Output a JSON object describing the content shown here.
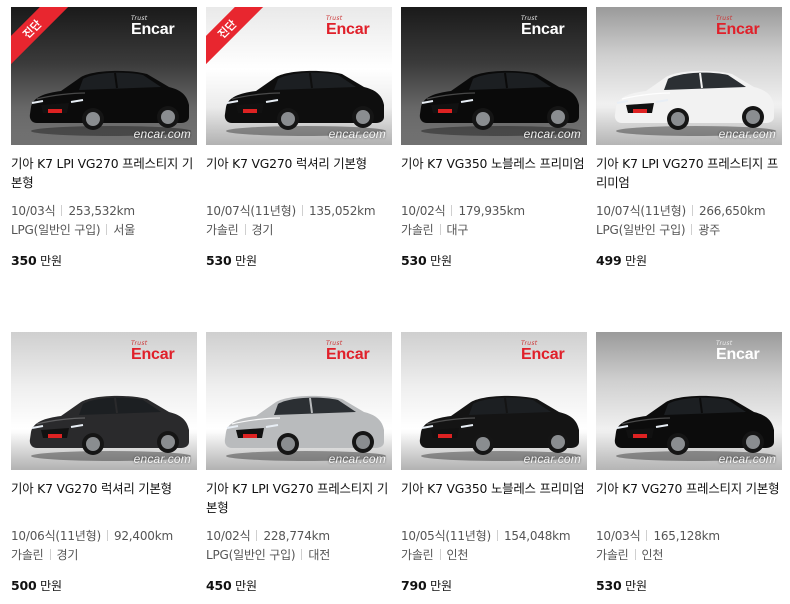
{
  "cars": [
    {
      "title": "기아 K7 LPI VG270 프레스티지 기본형",
      "year": "10/03식",
      "km": "253,532km",
      "fuel": "LPG(일반인 구입)",
      "region": "서울",
      "price": "350",
      "unit": "만원",
      "badge": "진단",
      "brand": "Encar",
      "brand_sub": "Trust",
      "watermark": "encar.com",
      "car_color": "#0b0b0b",
      "bg": "dark",
      "brand_style": "white"
    },
    {
      "title": "기아 K7 VG270 럭셔리 기본형",
      "year": "10/07식(11년형)",
      "km": "135,052km",
      "fuel": "가솔린",
      "region": "경기",
      "price": "530",
      "unit": "만원",
      "badge": "진단",
      "brand": "Encar",
      "brand_sub": "Trust",
      "watermark": "encar.com",
      "car_color": "#0e0e0e",
      "bg": "light",
      "brand_style": "red"
    },
    {
      "title": "기아 K7 VG350 노블레스 프리미엄",
      "year": "10/02식",
      "km": "179,935km",
      "fuel": "가솔린",
      "region": "대구",
      "price": "530",
      "unit": "만원",
      "badge": "",
      "brand": "Encar",
      "brand_sub": "Trust",
      "watermark": "encar.com",
      "car_color": "#0a0a0a",
      "bg": "dark",
      "brand_style": "white"
    },
    {
      "title": "기아 K7 LPI VG270 프레스티지 프리미엄",
      "year": "10/07식(11년형)",
      "km": "266,650km",
      "fuel": "LPG(일반인 구입)",
      "region": "광주",
      "price": "499",
      "unit": "만원",
      "badge": "",
      "brand": "Encar",
      "brand_sub": "Trust",
      "watermark": "encar.com",
      "car_color": "#f2f2f2",
      "bg": "studio2",
      "brand_style": "red"
    },
    {
      "title": "기아 K7 VG270 럭셔리 기본형",
      "year": "10/06식(11년형)",
      "km": "92,400km",
      "fuel": "가솔린",
      "region": "경기",
      "price": "500",
      "unit": "만원",
      "badge": "",
      "brand": "Encar",
      "brand_sub": "Trust",
      "watermark": "encar.com",
      "car_color": "#2a2a2c",
      "bg": "studio",
      "brand_style": "red"
    },
    {
      "title": "기아 K7 LPI VG270 프레스티지 기본형",
      "year": "10/02식",
      "km": "228,774km",
      "fuel": "LPG(일반인 구입)",
      "region": "대전",
      "price": "450",
      "unit": "만원",
      "badge": "",
      "brand": "Encar",
      "brand_sub": "Trust",
      "watermark": "encar.com",
      "car_color": "#b9bbbd",
      "bg": "studio",
      "brand_style": "red"
    },
    {
      "title": "기아 K7 VG350 노블레스 프리미엄",
      "year": "10/05식(11년형)",
      "km": "154,048km",
      "fuel": "가솔린",
      "region": "인천",
      "price": "790",
      "unit": "만원",
      "badge": "",
      "brand": "Encar",
      "brand_sub": "Trust",
      "watermark": "encar.com",
      "car_color": "#141414",
      "bg": "studio",
      "brand_style": "red"
    },
    {
      "title": "기아 K7 VG270 프레스티지 기본형",
      "year": "10/03식",
      "km": "165,128km",
      "fuel": "가솔린",
      "region": "인천",
      "price": "530",
      "unit": "만원",
      "badge": "",
      "brand": "Encar",
      "brand_sub": "Trust",
      "watermark": "encar.com",
      "car_color": "#0c0c0c",
      "bg": "studio2",
      "brand_style": "white"
    }
  ]
}
